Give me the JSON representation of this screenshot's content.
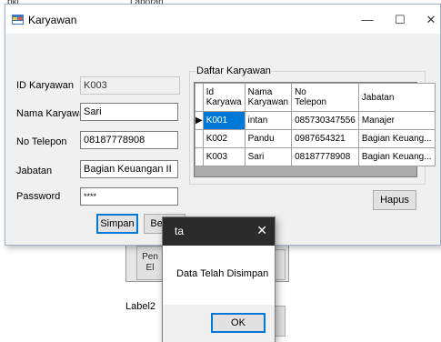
{
  "background": {
    "top_left_text": "pkj",
    "top_mid_text": "Laporan",
    "partial_button_1": "Pen\nEl",
    "label2": "Label2"
  },
  "window": {
    "title": "Karyawan",
    "minimize_glyph": "—",
    "maximize_glyph": "☐",
    "close_glyph": "✕"
  },
  "form": {
    "id_label": "ID Karyawan",
    "id_value": "K003",
    "name_label": "Nama Karyawan",
    "name_value": "Sari",
    "phone_label": "No Telepon",
    "phone_value": "08187778908",
    "job_label": "Jabatan",
    "job_value": "Bagian Keuangan II",
    "password_label": "Password",
    "password_value": "****",
    "save_button": "Simpan",
    "clear_button": "Bersih"
  },
  "group": {
    "title": "Daftar Karyawan",
    "delete_button": "Hapus"
  },
  "grid": {
    "columns": [
      "Id\nKaryawa",
      "Nama\nKaryawan",
      "No\nTelepon",
      "Jabatan"
    ],
    "rows": [
      {
        "id": "K001",
        "name": "intan",
        "phone": "085730347556",
        "job": "Manajer"
      },
      {
        "id": "K002",
        "name": "Pandu",
        "phone": "0987654321",
        "job": "Bagian Keuang..."
      },
      {
        "id": "K003",
        "name": "Sari",
        "phone": "08187778908",
        "job": "Bagian Keuang..."
      }
    ],
    "current_row_marker": "▶"
  },
  "dialog": {
    "title": "ta",
    "close_glyph": "✕",
    "message": "Data Telah Disimpan",
    "ok_button": "OK"
  },
  "colors": {
    "selection": "#0078d7",
    "dialog_title_bg": "#2b2b2b",
    "window_bg": "#f0f0f0"
  }
}
